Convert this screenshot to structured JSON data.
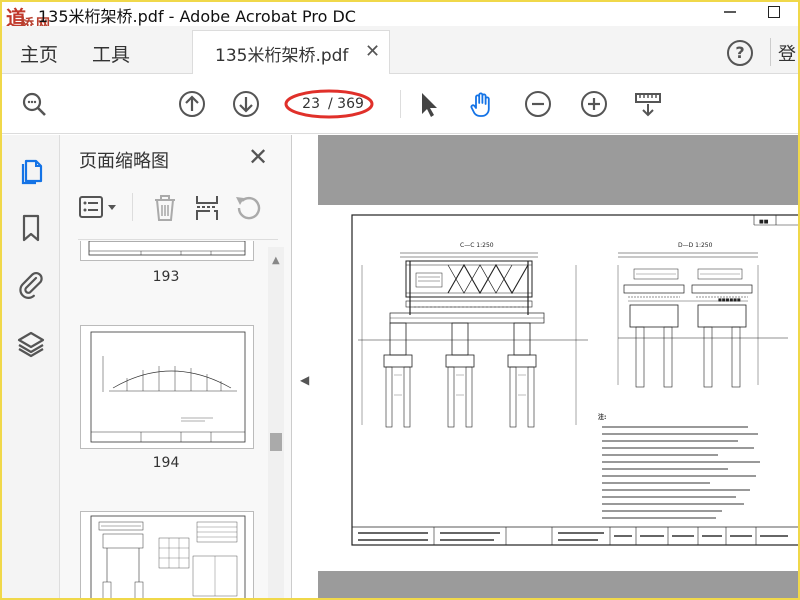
{
  "window": {
    "title": "135米桁架桥.pdf - Adobe Acrobat Pro DC",
    "watermark_a": "道",
    "watermark_b": "桥网"
  },
  "menu": {
    "home_label": "主页",
    "tools_label": "工具",
    "doc_tab_label": "135米桁架桥.pdf",
    "help_label": "?",
    "login_label": "登"
  },
  "toolbar": {
    "current_page": "23",
    "total_pages": "/ 369",
    "icons": [
      "search-icon",
      "prev-page-icon",
      "next-page-icon",
      "select-cursor-icon",
      "hand-tool-icon",
      "zoom-out-icon",
      "zoom-in-icon",
      "page-tools-icon"
    ],
    "highlight_color": "#e0302a",
    "accent_color": "#1473e6"
  },
  "sidebar": {
    "rail_icons": [
      "page-thumbnails-icon",
      "bookmark-icon",
      "attachment-icon",
      "layers-icon"
    ],
    "panel_title": "页面缩略图",
    "thumbnail_pages": [
      "193",
      "194"
    ]
  },
  "document": {
    "drawing_left_title": "C—C  1:250",
    "drawing_right_title": "D—D  1:250",
    "notes_heading": "注:"
  }
}
